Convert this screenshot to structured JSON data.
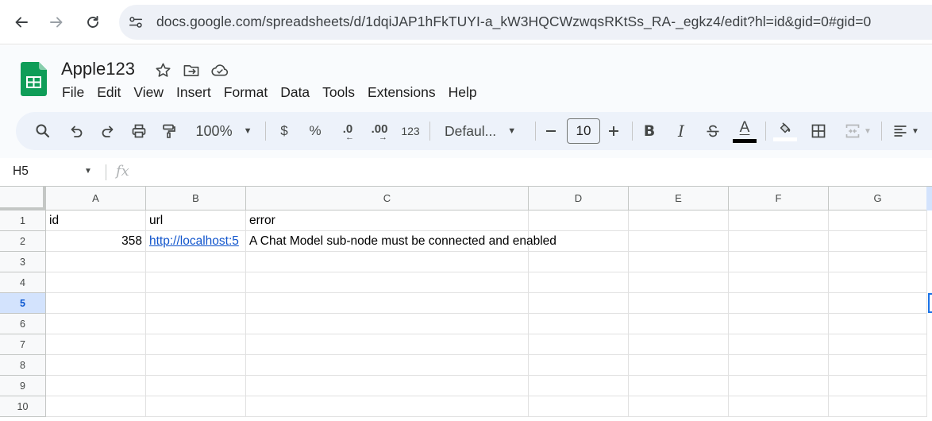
{
  "browser": {
    "url": "docs.google.com/spreadsheets/d/1dqiJAP1hFkTUYI-a_kW3HQCWzwqsRKtSs_RA-_egkz4/edit?hl=id&gid=0#gid=0"
  },
  "doc": {
    "title": "Apple123",
    "menu": [
      "File",
      "Edit",
      "View",
      "Insert",
      "Format",
      "Data",
      "Tools",
      "Extensions",
      "Help"
    ]
  },
  "toolbar": {
    "zoom": "100%",
    "currency": "$",
    "percent": "%",
    "dec_decrease": ".0",
    "dec_increase": ".00",
    "number_format": "123",
    "font": "Defaul...",
    "font_size": "10",
    "bold": "B",
    "italic": "I",
    "text_color_label": "A",
    "colors": {
      "text_color": "#000000",
      "fill_color": "#ffffff",
      "accent": "#0b57d0"
    }
  },
  "formula_bar": {
    "name_box": "H5",
    "fx": "fx",
    "content": ""
  },
  "grid": {
    "columns": [
      "A",
      "B",
      "C",
      "D",
      "E",
      "F",
      "G"
    ],
    "rows": [
      "1",
      "2",
      "3",
      "4",
      "5",
      "6",
      "7",
      "8",
      "9",
      "10"
    ],
    "active_row": "5",
    "cells": {
      "A1": "id",
      "B1": "url",
      "C1": "error",
      "A2": "358",
      "B2": "http://localhost:5",
      "C2": "A Chat Model sub-node must be connected and enabled"
    }
  }
}
